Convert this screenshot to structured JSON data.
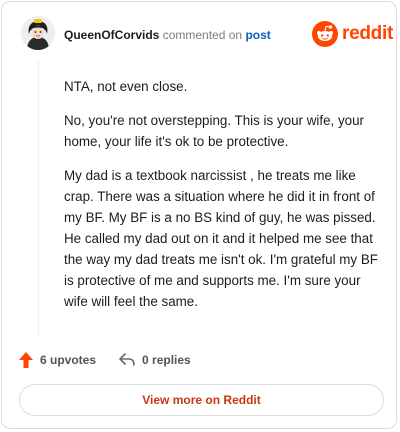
{
  "comment": {
    "author": "QueenOfCorvids",
    "action_text": "commented on",
    "post_link_text": "post",
    "paragraphs": [
      "NTA, not even close.",
      "No, you're not overstepping. This is your wife, your home, your life it's ok to be protective.",
      "My dad is a textbook narcissist , he treats me like crap. There was a situation where he did it in front of my BF. My BF is a no BS kind of guy, he was pissed. He called my dad out on it and it helped me see that the way my dad treats me isn't ok. I'm grateful my BF is protective of me and supports me. I'm sure your wife will feel the same."
    ],
    "upvotes": "6 upvotes",
    "replies": "0 replies"
  },
  "brand": {
    "wordmark": "reddit",
    "color": "#ff4500"
  },
  "footer": {
    "view_more_label": "View more on Reddit"
  },
  "icons": {
    "avatar": "avatar-icon",
    "logo": "reddit-logo-icon",
    "upvote": "upvote-arrow-icon",
    "reply": "reply-arrow-icon"
  }
}
